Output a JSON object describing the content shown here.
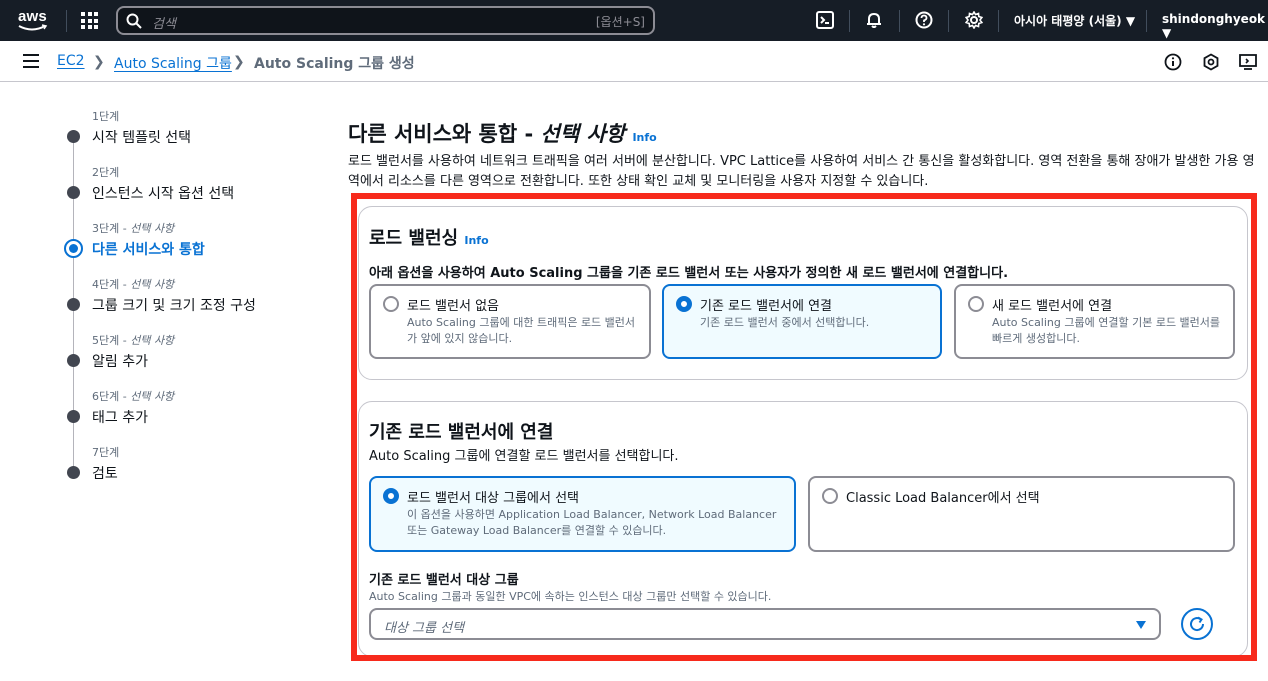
{
  "topnav": {
    "logo_text": "aws",
    "search_placeholder": "검색",
    "search_shortcut": "[옵션+S]",
    "region": "아시아 태평양 (서울)",
    "user": "shindonghyeok"
  },
  "breadcrumb": {
    "items": [
      "EC2",
      "Auto Scaling 그룹",
      "Auto Scaling 그룹 생성"
    ]
  },
  "wizard": {
    "steps": [
      {
        "num": "1단계",
        "optional": "",
        "name": "시작 템플릿 선택"
      },
      {
        "num": "2단계",
        "optional": "",
        "name": "인스턴스 시작 옵션 선택"
      },
      {
        "num": "3단계 - ",
        "optional": "선택 사항",
        "name": "다른 서비스와 통합"
      },
      {
        "num": "4단계 - ",
        "optional": "선택 사항",
        "name": "그룹 크기 및 크기 조정 구성"
      },
      {
        "num": "5단계 - ",
        "optional": "선택 사항",
        "name": "알림 추가"
      },
      {
        "num": "6단계 - ",
        "optional": "선택 사항",
        "name": "태그 추가"
      },
      {
        "num": "7단계",
        "optional": "",
        "name": "검토"
      }
    ],
    "active_index": 2
  },
  "main": {
    "title": "다른 서비스와 통합 - ",
    "title_optional": "선택 사항",
    "info": "Info",
    "description": "로드 밸런서를 사용하여 네트워크 트래픽을 여러 서버에 분산합니다. VPC Lattice를 사용하여 서비스 간 통신을 활성화합니다. 영역 전환을 통해 장애가 발생한 가용 영역에서 리소스를 다른 영역으로 전환합니다. 또한 상태 확인 교체 및 모니터링을 사용자 지정할 수 있습니다."
  },
  "load_balancing": {
    "title": "로드 밸런싱",
    "info": "Info",
    "description": "아래 옵션을 사용하여 Auto Scaling 그룹을 기존 로드 밸런서 또는 사용자가 정의한 새 로드 밸런서에 연결합니다.",
    "options": [
      {
        "label": "로드 밸런서 없음",
        "desc": "Auto Scaling 그룹에 대한 트래픽은 로드 밸런서가 앞에 있지 않습니다.",
        "selected": false
      },
      {
        "label": "기존 로드 밸런서에 연결",
        "desc": "기존 로드 밸런서 중에서 선택합니다.",
        "selected": true
      },
      {
        "label": "새 로드 밸런서에 연결",
        "desc": "Auto Scaling 그룹에 연결할 기본 로드 밸런서를 빠르게 생성합니다.",
        "selected": false
      }
    ]
  },
  "attach_existing": {
    "title": "기존 로드 밸런서에 연결",
    "description": "Auto Scaling 그룹에 연결할 로드 밸런서를 선택합니다.",
    "options": [
      {
        "label": "로드 밸런서 대상 그룹에서 선택",
        "desc": "이 옵션을 사용하면 Application Load Balancer, Network Load Balancer 또는 Gateway Load Balancer를 연결할 수 있습니다.",
        "selected": true
      },
      {
        "label": "Classic Load Balancer에서 선택",
        "desc": "",
        "selected": false
      }
    ],
    "target_group": {
      "label": "기존 로드 밸런서 대상 그룹",
      "desc": "Auto Scaling 그룹과 동일한 VPC에 속하는 인스턴스 대상 그룹만 선택할 수 있습니다.",
      "placeholder": "대상 그룹 선택"
    }
  },
  "colors": {
    "accent": "#0972d3",
    "highlight": "#f72a1c",
    "nav_bg": "#161d26"
  }
}
